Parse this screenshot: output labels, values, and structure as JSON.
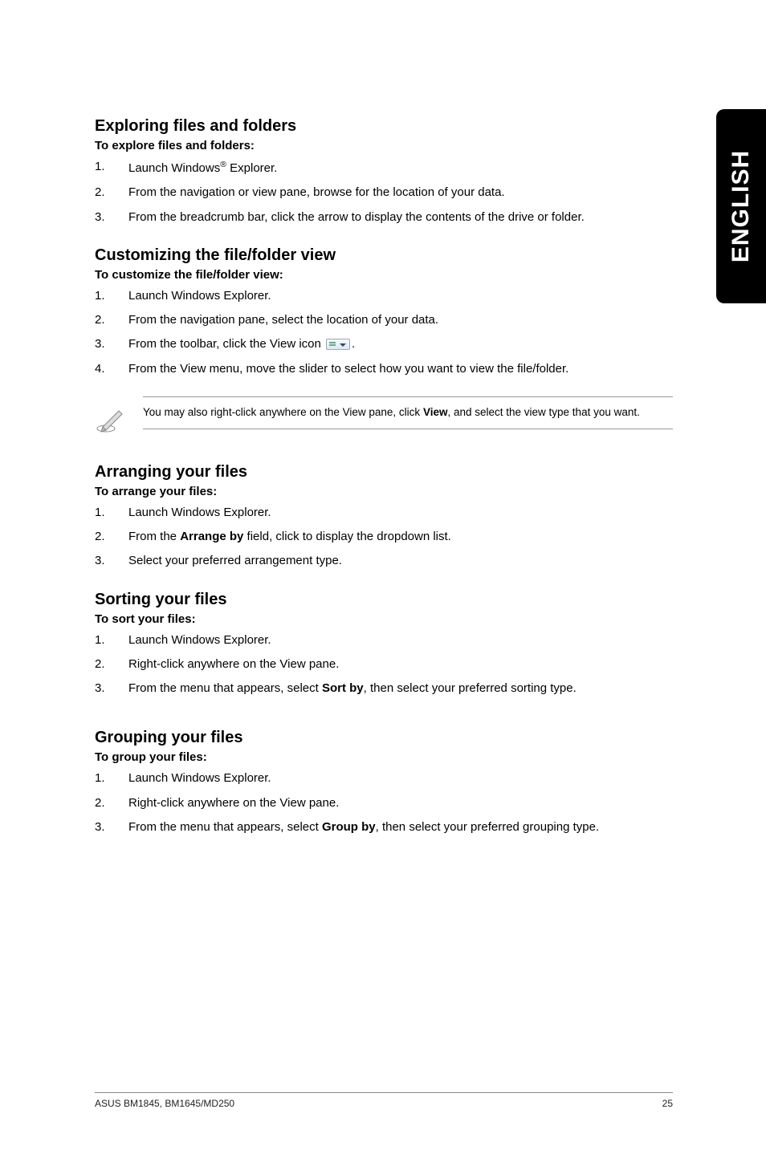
{
  "side_tab": "ENGLISH",
  "sections": {
    "exploring": {
      "heading": "Exploring files and folders",
      "sub": "To explore files and folders:",
      "steps": [
        {
          "n": "1.",
          "pre": "Launch Windows",
          "sup": "®",
          "post": " Explorer."
        },
        {
          "n": "2.",
          "text": "From the navigation or view pane, browse for the location of your data."
        },
        {
          "n": "3.",
          "text": "From the breadcrumb bar, click the arrow to display the contents of the drive or folder."
        }
      ]
    },
    "customizing": {
      "heading": "Customizing the file/folder view",
      "sub": "To customize the file/folder view:",
      "steps": [
        {
          "n": "1.",
          "text": "Launch Windows Explorer."
        },
        {
          "n": "2.",
          "text": "From the navigation pane, select the location of your data."
        },
        {
          "n": "3.",
          "pre": "From the toolbar, click the View icon ",
          "icon": true,
          "post": "."
        },
        {
          "n": "4.",
          "text": "From the View menu, move the slider to select how you want to view the file/folder."
        }
      ],
      "note_pre": "You may also right-click anywhere on the View pane, click ",
      "note_bold": "View",
      "note_post": ", and select the view type that you want."
    },
    "arranging": {
      "heading": "Arranging your files",
      "sub": "To arrange your files:",
      "steps": [
        {
          "n": "1.",
          "text": "Launch Windows Explorer."
        },
        {
          "n": "2.",
          "pre": "From the ",
          "bold": "Arrange by",
          "post": " field, click to display the dropdown list."
        },
        {
          "n": "3.",
          "text": "Select your preferred arrangement type."
        }
      ]
    },
    "sorting": {
      "heading": "Sorting your files",
      "sub": "To sort your files:",
      "steps": [
        {
          "n": "1.",
          "text": "Launch Windows Explorer."
        },
        {
          "n": "2.",
          "text": "Right-click anywhere on the View pane."
        },
        {
          "n": "3.",
          "pre": "From the menu that appears, select ",
          "bold": "Sort by",
          "post": ", then select your preferred sorting type."
        }
      ]
    },
    "grouping": {
      "heading": "Grouping your files",
      "sub": "To group your files:",
      "steps": [
        {
          "n": "1.",
          "text": "Launch Windows Explorer."
        },
        {
          "n": "2.",
          "text": "Right-click anywhere on the View pane."
        },
        {
          "n": "3.",
          "pre": "From the menu that appears, select ",
          "bold": "Group by",
          "post": ", then select your preferred grouping type."
        }
      ]
    }
  },
  "footer": {
    "left": "ASUS BM1845, BM1645/MD250",
    "right": "25"
  }
}
